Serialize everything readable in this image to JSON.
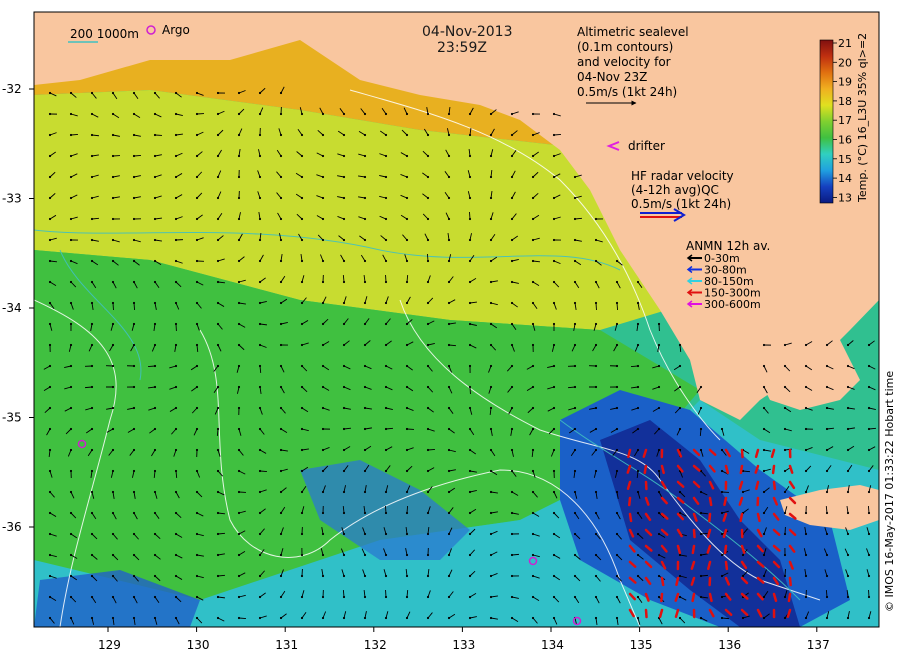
{
  "header": {
    "date": "04-Nov-2013",
    "time": "23:59Z"
  },
  "scale_legend": {
    "contours": "200  1000m",
    "argo_label": "Argo",
    "argo_color": "#d020d0",
    "contour_color": "#40c0c0"
  },
  "altimetry_legend": {
    "lines": [
      "Altimetric sealevel",
      "(0.1m contours)",
      "and velocity for",
      "04-Nov 23Z",
      "0.5m/s (1kt 24h)"
    ]
  },
  "drifter_legend": {
    "label": "drifter",
    "color": "#e020e0"
  },
  "hf_radar_legend": {
    "lines": [
      "HF radar velocity",
      "(4-12h avg)QC",
      "0.5m/s (1kt 24h)"
    ],
    "colors": [
      "#1020d0",
      "#e01010"
    ]
  },
  "anmn_legend": {
    "title": "ANMN 12h av.",
    "items": [
      {
        "label": "0-30m",
        "color": "#000000"
      },
      {
        "label": "30-80m",
        "color": "#1030e0"
      },
      {
        "label": "80-150m",
        "color": "#30d0e0"
      },
      {
        "label": "150-300m",
        "color": "#e01010"
      },
      {
        "label": "300-600m",
        "color": "#e010e0"
      }
    ]
  },
  "colorbar": {
    "title": "Temp. (°C) 16_L3U 35% ql>=2",
    "ticks": [
      "21",
      "20",
      "19",
      "18",
      "17",
      "16",
      "15",
      "14",
      "13"
    ],
    "min": 12.5,
    "max": 21,
    "colors": [
      "#0a1a80",
      "#1540c0",
      "#20a0e0",
      "#30d0c0",
      "#40c040",
      "#80d030",
      "#e0e020",
      "#f0b020",
      "#e07010",
      "#c03010",
      "#801010"
    ]
  },
  "axes": {
    "x_ticks": [
      "129",
      "130",
      "131",
      "132",
      "133",
      "134",
      "135",
      "136",
      "137"
    ],
    "y_ticks": [
      "-32",
      "-33",
      "-34",
      "-35",
      "-36"
    ]
  },
  "credit": "© IMOS 16-May-2017 01:33:22 Hobart time",
  "map_colors": {
    "land": "#f9c69f",
    "warm": "#e8b020",
    "yellow": "#d8e030",
    "green": "#40c040",
    "teal": "#30c0a0",
    "cyan": "#30c0d0",
    "blue": "#1050c0",
    "navy": "#102080"
  }
}
